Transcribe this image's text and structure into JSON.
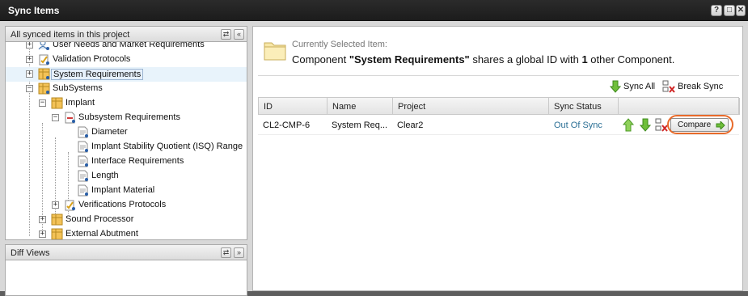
{
  "window": {
    "title": "Sync Items",
    "buttons": [
      "?",
      "□",
      "✕"
    ]
  },
  "left_panel": {
    "header": "All synced items in this project",
    "tree": [
      {
        "label": "User Needs and Market Requirements",
        "icon": "user-needs-icon",
        "toggle": "+"
      },
      {
        "label": "Validation Protocols",
        "icon": "protocol-icon",
        "toggle": "+"
      },
      {
        "label": "System Requirements",
        "icon": "component-icon",
        "toggle": "+"
      },
      {
        "label": "SubSystems",
        "icon": "component-icon",
        "toggle": "−"
      },
      {
        "label": "Implant",
        "icon": "component-icon",
        "toggle": "−"
      },
      {
        "label": "Subsystem Requirements",
        "icon": "requirements-doc-icon",
        "toggle": "−"
      },
      {
        "label": "Diameter",
        "icon": "document-icon",
        "toggle": ""
      },
      {
        "label": "Implant Stability Quotient (ISQ) Range",
        "icon": "document-icon",
        "toggle": ""
      },
      {
        "label": "Interface Requirements",
        "icon": "document-icon",
        "toggle": ""
      },
      {
        "label": "Length",
        "icon": "document-icon",
        "toggle": ""
      },
      {
        "label": "Implant Material",
        "icon": "document-icon",
        "toggle": ""
      },
      {
        "label": "Verifications Protocols",
        "icon": "protocol-icon",
        "toggle": "+"
      },
      {
        "label": "Sound Processor",
        "icon": "component-icon",
        "toggle": "+"
      },
      {
        "label": "External Abutment",
        "icon": "component-icon",
        "toggle": "+"
      }
    ]
  },
  "diff_panel": {
    "header": "Diff Views"
  },
  "selected": {
    "caption": "Currently Selected Item:",
    "line_prefix": "Component ",
    "item_name": "\"System Requirements\"",
    "line_middle": " shares a global ID with ",
    "count": "1",
    "line_suffix": " other Component."
  },
  "toolbar": {
    "sync_all": "Sync All",
    "break_sync": "Break Sync"
  },
  "grid": {
    "columns": [
      "ID",
      "Name",
      "Project",
      "Sync Status",
      ""
    ],
    "rows": [
      {
        "id": "CL2-CMP-6",
        "name": "System Req...",
        "project": "Clear2",
        "status": "Out Of Sync",
        "action": "Compare"
      }
    ]
  },
  "colors": {
    "titlebar": "#1c1c1c",
    "link": "#2a6f95",
    "highlight_oval": "#e86a2a",
    "selected_row": "#e8f3fb"
  }
}
